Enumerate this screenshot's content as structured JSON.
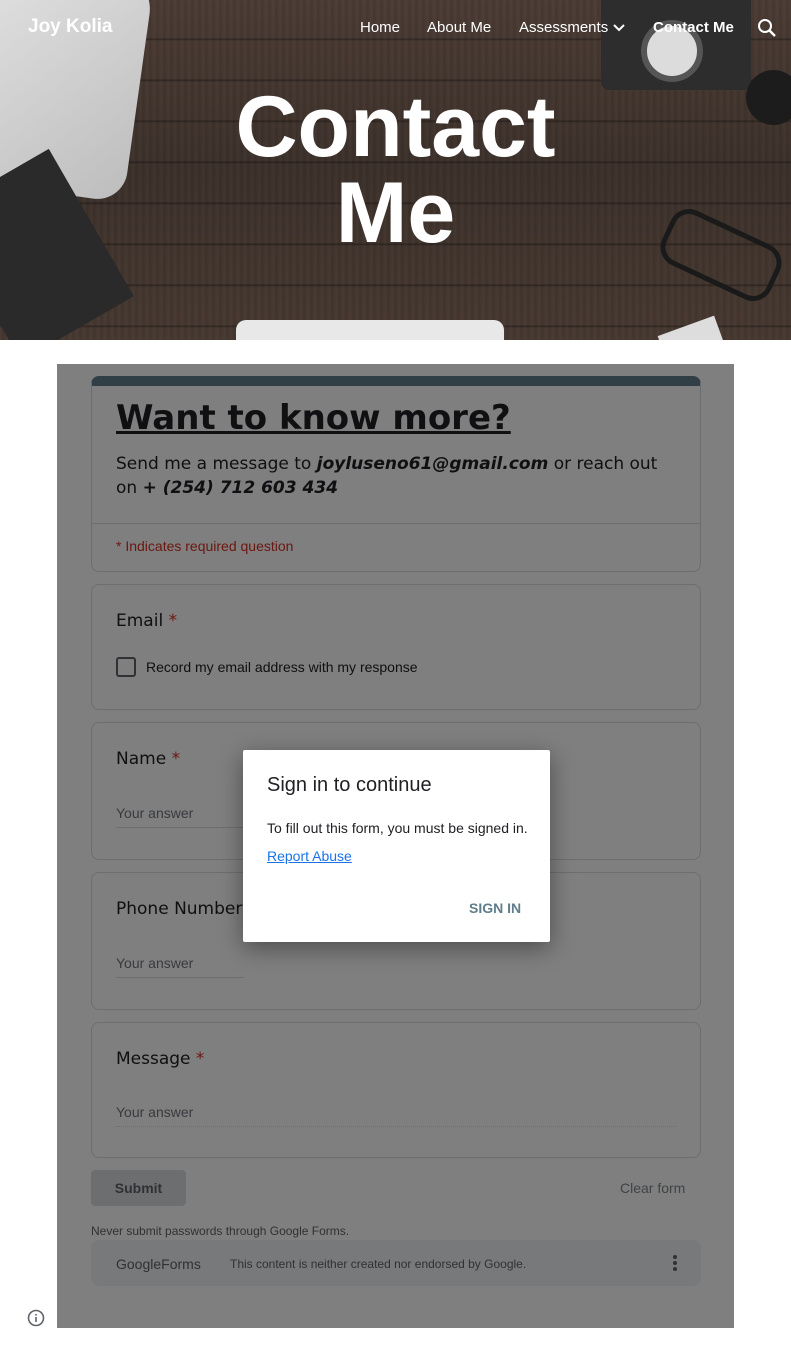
{
  "site": {
    "title": "Joy Kolia",
    "nav": [
      "Home",
      "About Me",
      "Assessments",
      "Contact Me"
    ],
    "active_nav": "Contact Me",
    "hero_title_line1": "Contact",
    "hero_title_line2": "Me"
  },
  "form": {
    "title": "Want to know more?",
    "desc_prefix": "Send me a message to ",
    "desc_email": "joyluseno61@gmail.com",
    "desc_mid": " or reach out on ",
    "desc_phone": "+ (254) 712 603 434",
    "required_note": "* Indicates required question",
    "accent_color": "#607d8b",
    "questions": [
      {
        "label": "Email",
        "star": "*",
        "checkbox_label": "Record my email address with my response"
      },
      {
        "label": "Name",
        "star": "*",
        "placeholder": "Your answer"
      },
      {
        "label": "Phone Number",
        "star": "*",
        "placeholder": "Your answer"
      },
      {
        "label": "Message",
        "star": "*",
        "placeholder": "Your answer"
      }
    ],
    "submit_label": "Submit",
    "clear_label": "Clear form",
    "never_submit": "Never submit passwords through Google Forms.",
    "footer_brand_google": "Google",
    "footer_brand_forms": "Forms",
    "footer_disclaimer": "This content is neither created nor endorsed by Google."
  },
  "dialog": {
    "title": "Sign in to continue",
    "text": "To fill out this form, you must be signed in.",
    "link": "Report Abuse",
    "button": "SIGN IN"
  },
  "icons": {
    "search": "search-icon",
    "chevron": "chevron-down-icon",
    "info": "info-icon",
    "more": "more-vertical-icon"
  }
}
